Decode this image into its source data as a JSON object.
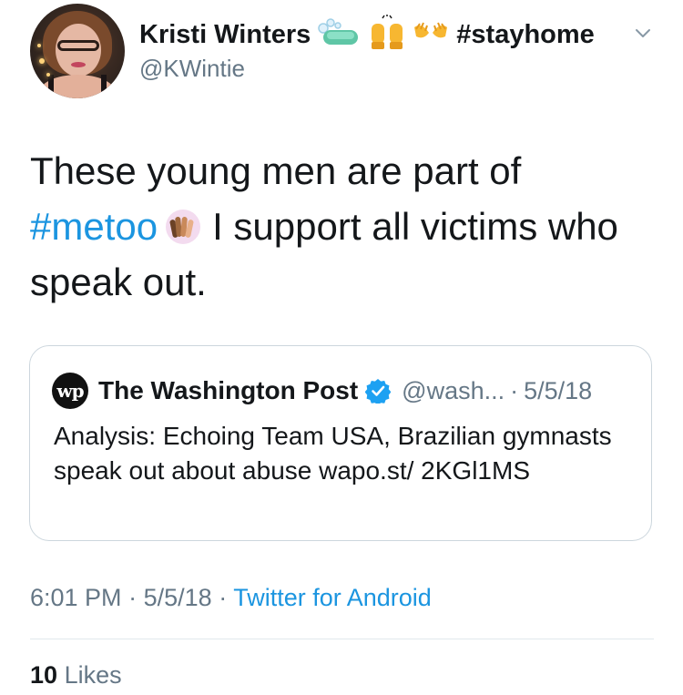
{
  "author": {
    "display_name": "Kristi Winters",
    "name_emojis": [
      "soap-emoji",
      "raised-hands-emoji",
      "open-hands-emoji"
    ],
    "name_hashtag": "#stayhome",
    "handle": "@KWintie"
  },
  "tweet": {
    "text_before": "These young men are part of",
    "hashtag": "#metoo",
    "emoji": "raising-hands-multiple-skin-tones-emoji",
    "text_after": "I support all victims who speak out."
  },
  "quoted_tweet": {
    "logo_text": "wp",
    "name": "The Washington Post",
    "verified": true,
    "handle": "@wash...",
    "separator": "·",
    "date": "5/5/18",
    "text": "Analysis: Echoing Team USA, Brazilian gymnasts speak out about abuse wapo.st/ 2KGl1MS"
  },
  "meta": {
    "time": "6:01 PM",
    "separator": "·",
    "date": "5/5/18",
    "source": "Twitter for Android"
  },
  "engagement": {
    "likes_count": "10",
    "likes_label": "Likes"
  },
  "colors": {
    "link": "#1b95e0",
    "secondary_text": "#657786",
    "primary_text": "#14171a",
    "border": "#ccd6dd"
  }
}
